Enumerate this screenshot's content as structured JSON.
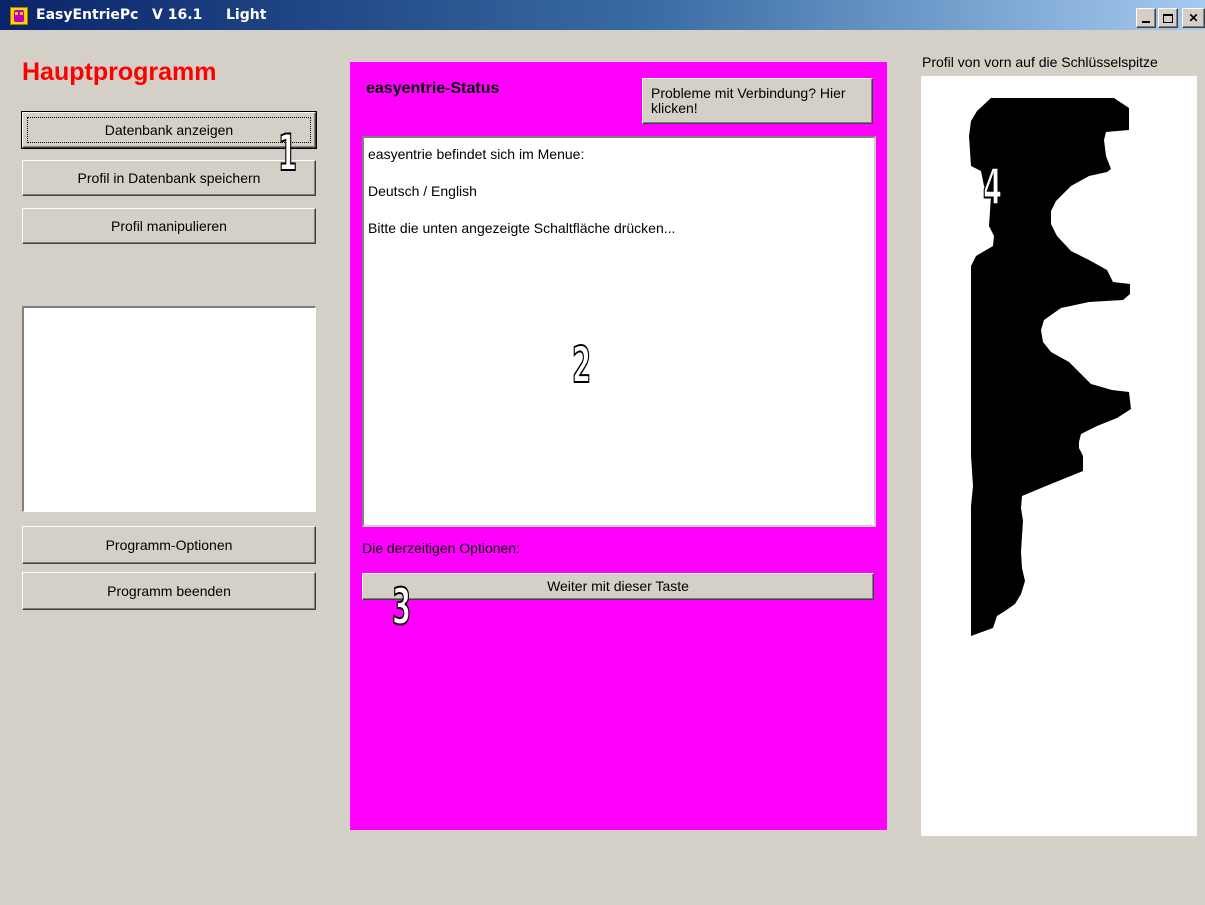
{
  "window": {
    "app_name": "EasyEntriePc",
    "version": "V 16.1",
    "edition": "Light"
  },
  "left": {
    "title": "Hauptprogramm",
    "buttons": {
      "show_db": "Datenbank anzeigen",
      "save_profile": "Profil in Datenbank speichern",
      "manipulate": "Profil manipulieren",
      "options": "Programm-Optionen",
      "exit": "Programm beenden"
    }
  },
  "center": {
    "title": "easyentrie-Status",
    "connection_button": "Probleme mit Verbindung? Hier klicken!",
    "status_lines": [
      "easyentrie befindet sich im Menue:",
      "Deutsch / English",
      "Bitte die unten angezeigte Schaltfläche drücken..."
    ],
    "options_label": "Die derzeitigen Optionen:",
    "continue_button": "Weiter mit dieser Taste",
    "panel_color": "#ff00ff"
  },
  "right": {
    "profile_label": "Profil von vorn auf die Schlüsselspitze"
  },
  "overlays": [
    "1",
    "2",
    "3",
    "4"
  ]
}
